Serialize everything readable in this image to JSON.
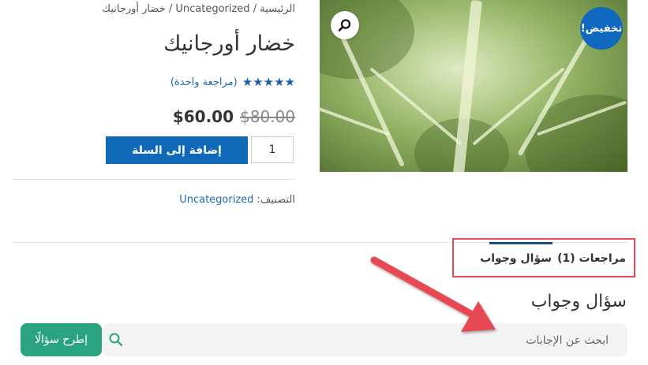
{
  "breadcrumb": {
    "home": "الرئيسية",
    "sep1": " / ",
    "category": "Uncategorized",
    "sep2": " / ",
    "current": "خضار أورجانيك"
  },
  "product": {
    "title": "خضار أورجانيك",
    "rating": 5,
    "rating_stars": "★★★★★",
    "review_link": "(مراجعة واحدة)",
    "price_old": "$80.00",
    "price_new": "$60.00",
    "quantity": "1",
    "add_to_cart": "إضافة إلى السلة",
    "category_label": "التصنيف:",
    "category_value": "Uncategorized",
    "sale_badge": "تخفيض!"
  },
  "tabs": [
    {
      "label": "مراجعات (1)",
      "active": false
    },
    {
      "label": "سؤال وجواب",
      "active": true
    }
  ],
  "qa": {
    "title": "سؤال وجواب",
    "search_placeholder": "ابحث عن الإجابات",
    "ask_button": "إطرح سؤالًا"
  },
  "colors": {
    "primary": "#0f68b8",
    "ask": "#2aa47e",
    "highlight": "#e64a52"
  },
  "icons": {
    "zoom": "magnifier-icon",
    "search": "search-icon"
  }
}
